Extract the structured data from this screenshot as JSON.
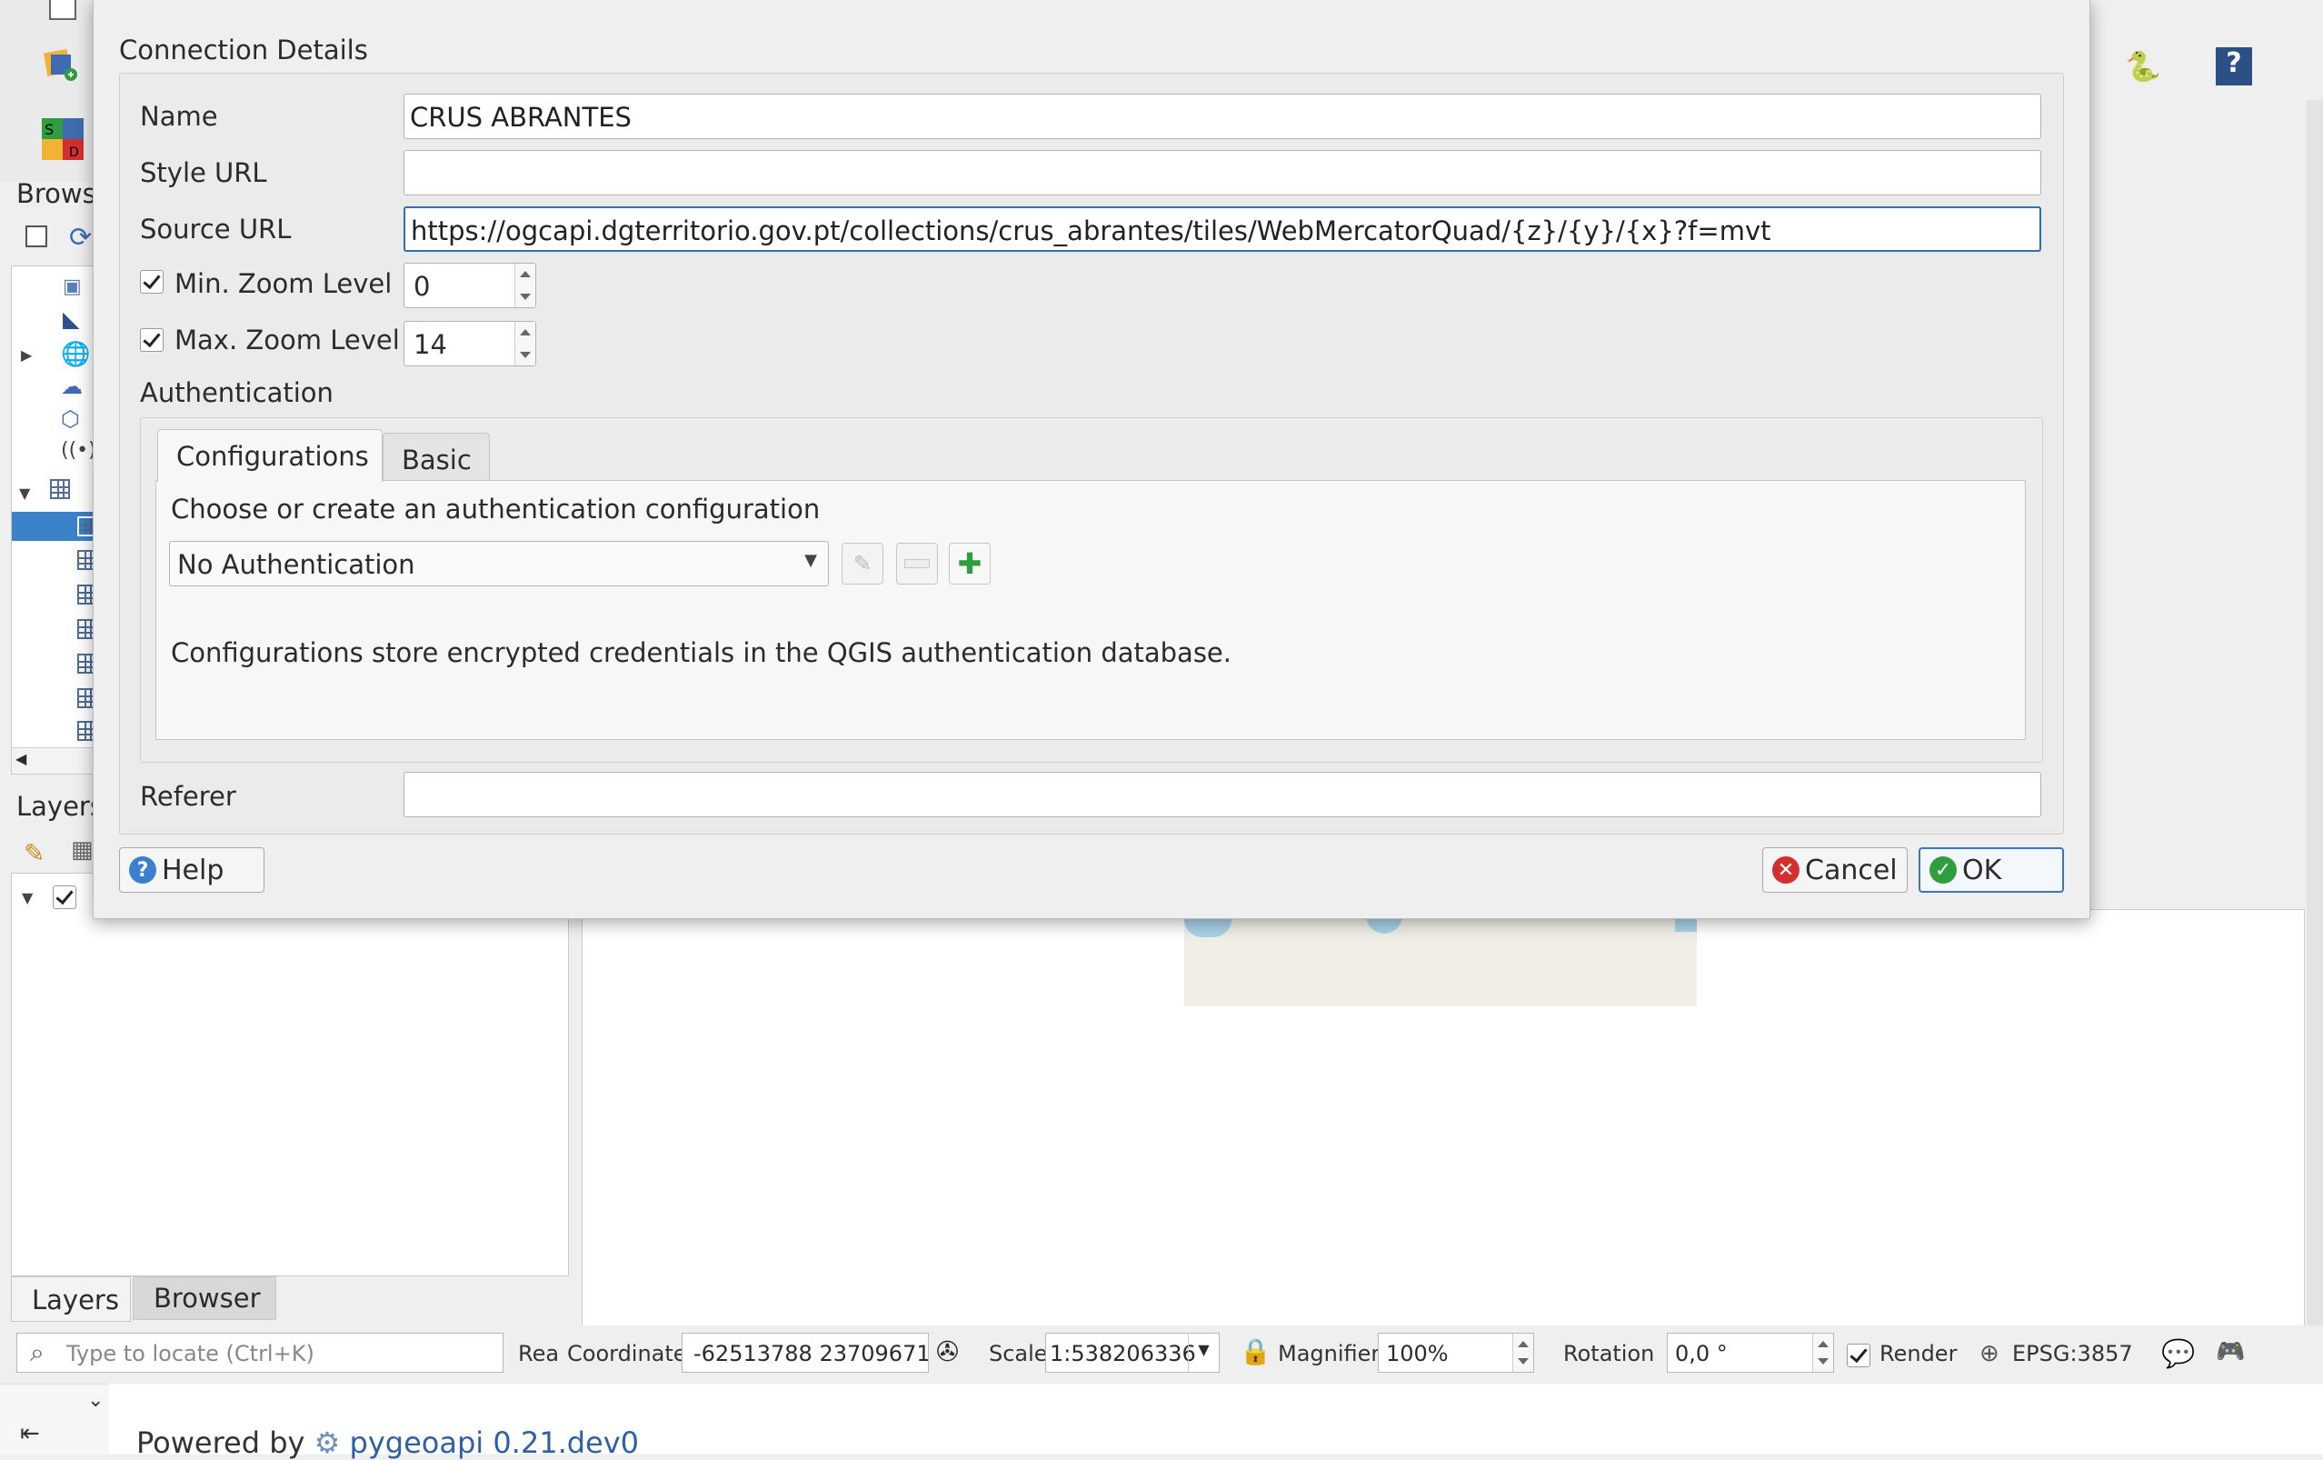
{
  "background": {
    "browser_panel_title": "Brows",
    "layers_panel_title": "Layers",
    "bottom_tabs": [
      "Layers",
      "Browser"
    ],
    "locator_placeholder": "Type to locate (Ctrl+K)",
    "status_truncated": "Rea",
    "coordinate_label": "Coordinate",
    "coordinate_value": "-62513788  23709671",
    "scale_label": "Scale",
    "scale_value": "1:538206336",
    "magnifier_label": "Magnifier",
    "magnifier_value": "100%",
    "rotation_label": "Rotation",
    "rotation_value": "0,0 °",
    "render_label": "Render",
    "render_checked": true,
    "crs_label": "EPSG:3857",
    "footer_text": "Powered by",
    "footer_brand": "pygeoapi 0.21.dev0"
  },
  "dialog": {
    "group_title": "Connection Details",
    "name_label": "Name",
    "name_value": "CRUS ABRANTES",
    "style_url_label": "Style URL",
    "style_url_value": "",
    "source_url_label": "Source URL",
    "source_url_value": "https://ogcapi.dgterritorio.gov.pt/collections/crus_abrantes/tiles/WebMercatorQuad/{z}/{y}/{x}?f=mvt",
    "min_zoom_label": "Min. Zoom Level",
    "min_zoom_checked": true,
    "min_zoom_value": "0",
    "max_zoom_label": "Max. Zoom Level",
    "max_zoom_checked": true,
    "max_zoom_value": "14",
    "auth_title": "Authentication",
    "tabs": [
      "Configurations",
      "Basic"
    ],
    "active_tab": "Configurations",
    "auth_prompt": "Choose or create an authentication configuration",
    "auth_selected": "No Authentication",
    "auth_note": "Configurations store encrypted credentials in the QGIS authentication database.",
    "referer_label": "Referer",
    "referer_value": "",
    "help_button": "Help",
    "cancel_button": "Cancel",
    "ok_button": "OK"
  },
  "colors": {
    "selection_blue": "#3b82c9",
    "focus_border": "#2f6fb4",
    "cancel_icon": "#d32f2f",
    "ok_icon": "#2e9e3e",
    "help_icon": "#3a7fd0"
  }
}
